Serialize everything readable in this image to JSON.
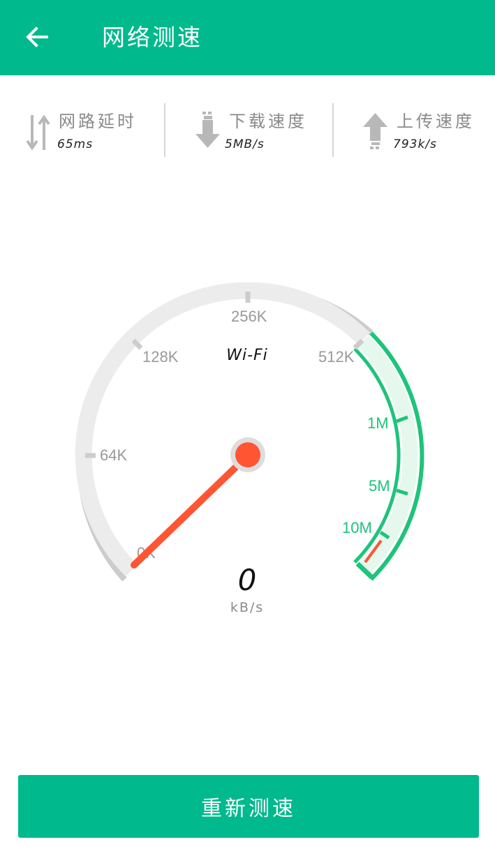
{
  "header": {
    "title": "网络测速",
    "back_icon": "arrow-left-icon"
  },
  "stats": [
    {
      "label": "网路延时",
      "value": "65ms",
      "icon": "latency-arrows-icon"
    },
    {
      "label": "下载速度",
      "value": "5MB/s",
      "icon": "download-arrow-icon"
    },
    {
      "label": "上传速度",
      "value": "793k/s",
      "icon": "upload-arrow-icon"
    }
  ],
  "gauge": {
    "network_type": "Wi-Fi",
    "tick_labels": [
      "0K",
      "64K",
      "128K",
      "256K",
      "512K",
      "1M",
      "5M",
      "10M"
    ],
    "speed_value": "0",
    "speed_unit": "kB/s",
    "needle_at": "0K"
  },
  "actions": {
    "retest_label": "重新测速"
  },
  "colors": {
    "primary": "#00b98c",
    "gauge_track": "#cccccc",
    "gauge_active": "#1dc47a",
    "needle": "#ff5533"
  }
}
